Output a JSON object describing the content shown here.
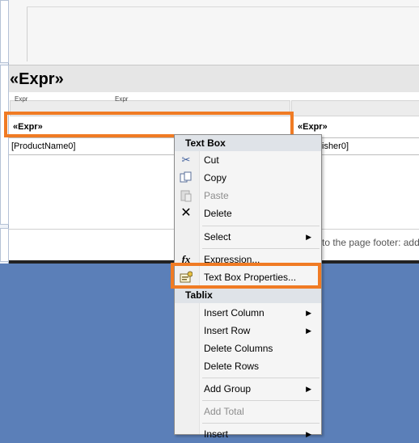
{
  "report": {
    "title": "«Expr»",
    "column_headers": [
      "Expr",
      "Expr"
    ],
    "cell_expr_left": "«Expr»",
    "cell_expr_right": "«Expr»",
    "cell_product": "[ProductName0]",
    "cell_publisher": "isher0]",
    "footer_hint": "to the page footer: add"
  },
  "context_menu": {
    "section_textbox": "Text Box",
    "cut": "Cut",
    "copy": "Copy",
    "paste": "Paste",
    "delete": "Delete",
    "select": "Select",
    "expression": "Expression...",
    "textbox_properties": "Text Box Properties...",
    "section_tablix": "Tablix",
    "insert_column": "Insert Column",
    "insert_row": "Insert Row",
    "delete_columns": "Delete Columns",
    "delete_rows": "Delete Rows",
    "add_group": "Add Group",
    "add_total": "Add Total",
    "insert": "Insert"
  },
  "colors": {
    "highlight": "#f07b24",
    "background": "#5b7fb8"
  }
}
